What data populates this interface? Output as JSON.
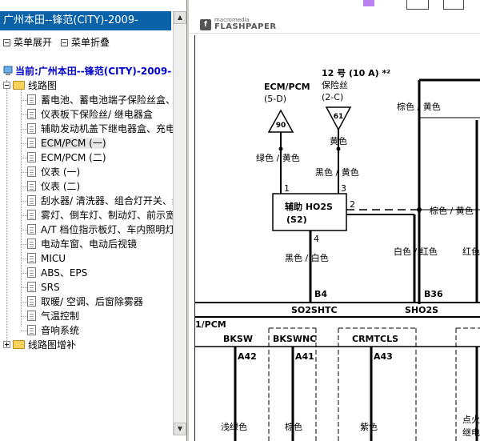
{
  "nav": {
    "title": "广州本田--锋范(CITY)-2009-",
    "expand_all": "菜单展开",
    "collapse_all": "菜单折叠",
    "root": "当前:广州本田--锋范(CITY)-2009-",
    "folder_wiring": "线路图",
    "folder_supplement": "线路图增补",
    "items": [
      "蓄电池、蓄电池端子保险丝盒、仪",
      "仪表板下保险丝/ 继电器盒",
      "辅助发动机盖下继电器盒、充电系",
      "ECM/PCM (一)",
      "ECM/PCM (二)",
      "仪表 (一)",
      "仪表 (二)",
      "刮水器/ 清洗器、组合灯开关、线",
      "雾灯、倒车灯、制动灯、前示宽灯",
      "A/T 档位指示板灯、车内照明灯、",
      "电动车窗、电动后视镜",
      "MICU",
      "ABS、EPS",
      "SRS",
      "取暖/ 空调、后窗除雾器",
      "气温控制",
      "音响系统"
    ],
    "selected_index": 3
  },
  "viewer": {
    "logo_top": "macromedia",
    "logo_main": "FLASHPAPER"
  },
  "schematic": {
    "ecm_label": "ECM/PCM",
    "ecm_sub": "(5-D)",
    "ecm_num": "90",
    "fuse_label": "12 号 (10 A) *²",
    "fuse_name": "保险丝",
    "fuse_sub": "(2-C)",
    "fuse_num": "61",
    "wire_brown_yellow_top": "棕色 / 黄色",
    "wire_yellow": "黄色",
    "wire_green_yellow": "绿色 / 黄色",
    "wire_black_yellow": "黑色 / 黄色",
    "sensor_label": "辅助 HO2S",
    "sensor_sub": "(S2)",
    "pin1": "1",
    "pin2": "2",
    "pin3": "3",
    "pin4": "4",
    "wire_brown_yellow_right": "棕色 / 黄色",
    "wire_black_white": "黑色 / 白色",
    "wire_white_red": "白色 / 红色",
    "wire_red_partial": "红色 / 白",
    "conn_b4": "B4",
    "conn_b36": "B36",
    "so2shtc": "SO2SHTC",
    "sho2s": "SHO2S",
    "pcm_label": "1/PCM",
    "bksw": "BKSW",
    "bkswnc": "BKSWNC",
    "crmtcls": "CRMTCLS",
    "a42": "A42",
    "a41": "A41",
    "a43": "A43",
    "wire_light_green": "浅绿色",
    "wire_brown": "棕色",
    "wire_purple": "紫色",
    "note_partial_1": "点火",
    "note_partial_2": "继电"
  }
}
